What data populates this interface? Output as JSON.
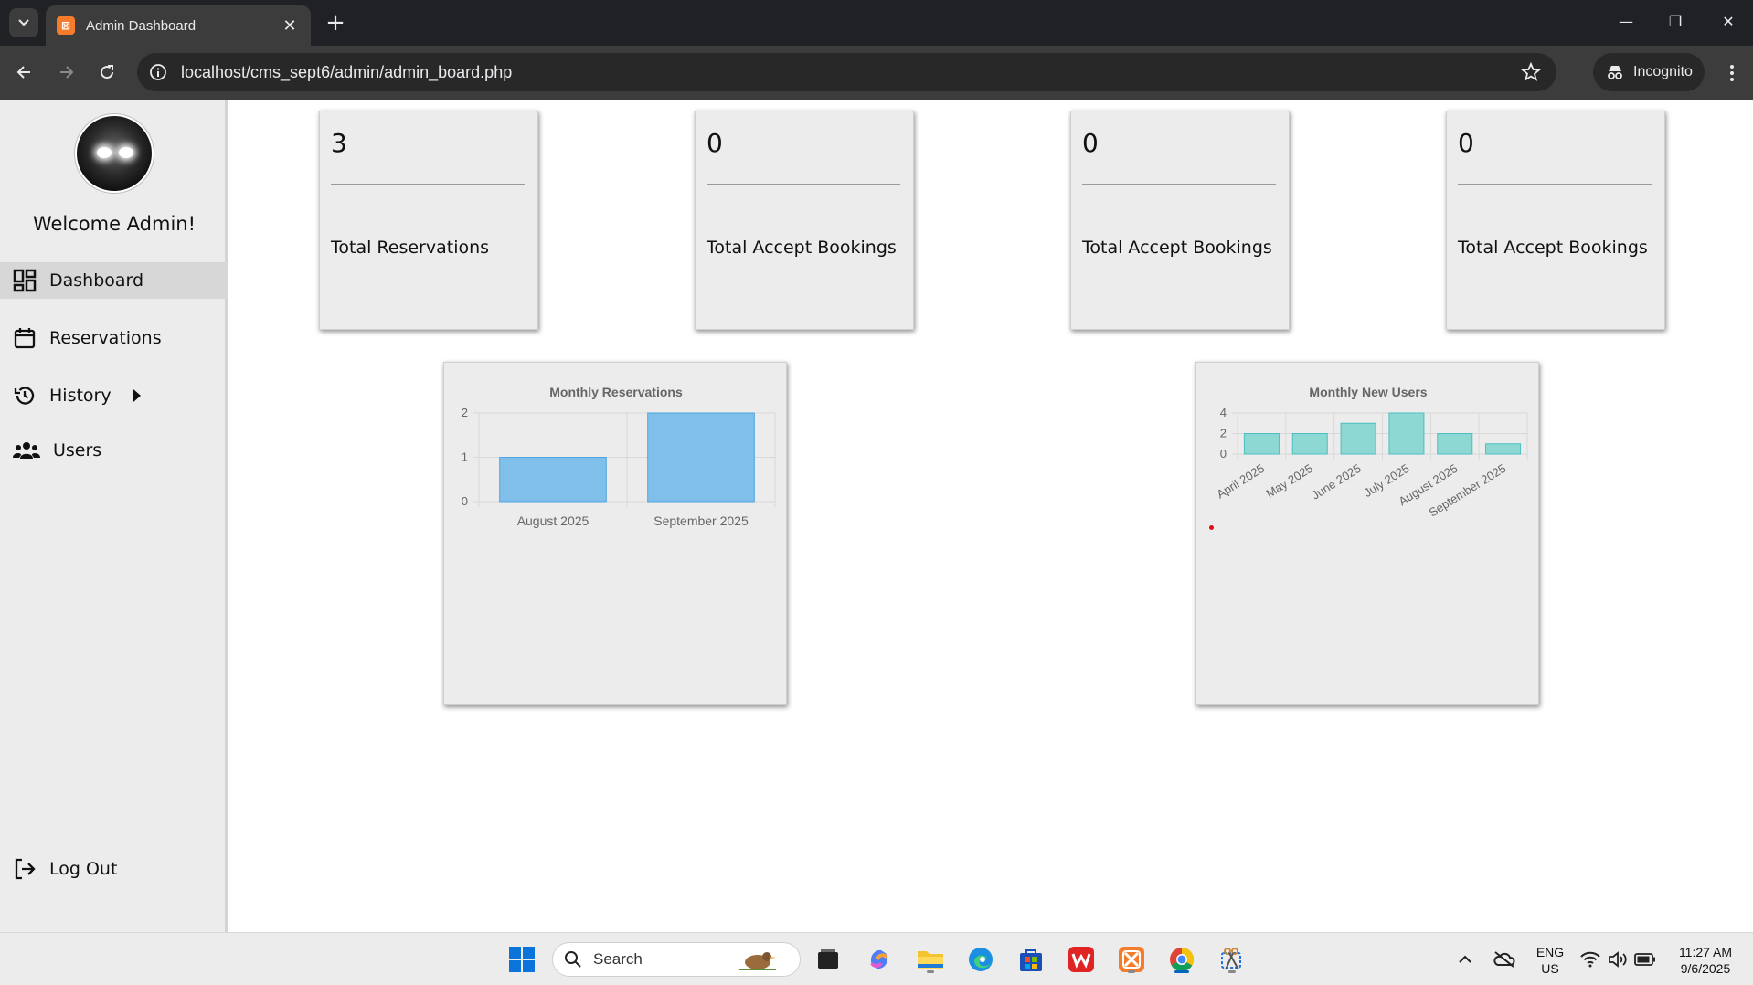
{
  "browser": {
    "tab_title": "Admin Dashboard",
    "tab_favicon_text": "⊠",
    "url": "localhost/cms_sept6/admin/admin_board.php",
    "incognito_label": "Incognito"
  },
  "sidebar": {
    "welcome": "Welcome Admin!",
    "items": [
      {
        "label": "Dashboard",
        "icon": "dashboard-icon",
        "active": true
      },
      {
        "label": "Reservations",
        "icon": "calendar-icon"
      },
      {
        "label": "History",
        "icon": "history-icon"
      },
      {
        "label": "Users",
        "icon": "users-icon"
      }
    ],
    "logout": "Log Out"
  },
  "cards": [
    {
      "value": "3",
      "label": "Total Reservations"
    },
    {
      "value": "0",
      "label": "Total Accept Bookings"
    },
    {
      "value": "0",
      "label": "Total Accept Bookings"
    },
    {
      "value": "0",
      "label": "Total Accept Bookings"
    }
  ],
  "chart_data": [
    {
      "type": "bar",
      "title": "Monthly Reservations",
      "categories": [
        "August 2025",
        "September 2025"
      ],
      "values": [
        1,
        2
      ],
      "ylim": [
        0,
        2
      ],
      "yticks": [
        "0",
        "1",
        "2"
      ],
      "grid": true,
      "color": "#7fbfea",
      "border_color": "#4ea5e0"
    },
    {
      "type": "bar",
      "title": "Monthly New Users",
      "categories": [
        "April 2025",
        "May 2025",
        "June 2025",
        "July 2025",
        "August 2025",
        "September 2025"
      ],
      "values": [
        2,
        2,
        3,
        4,
        2,
        1
      ],
      "ylim": [
        0,
        4
      ],
      "yticks": [
        "0",
        "2",
        "4"
      ],
      "grid": true,
      "color": "#8ed8d4",
      "border_color": "#4bc0c0"
    }
  ],
  "taskbar": {
    "search_placeholder": "Search",
    "lang_line1": "ENG",
    "lang_line2": "US",
    "time": "11:27 AM",
    "date": "9/6/2025"
  }
}
